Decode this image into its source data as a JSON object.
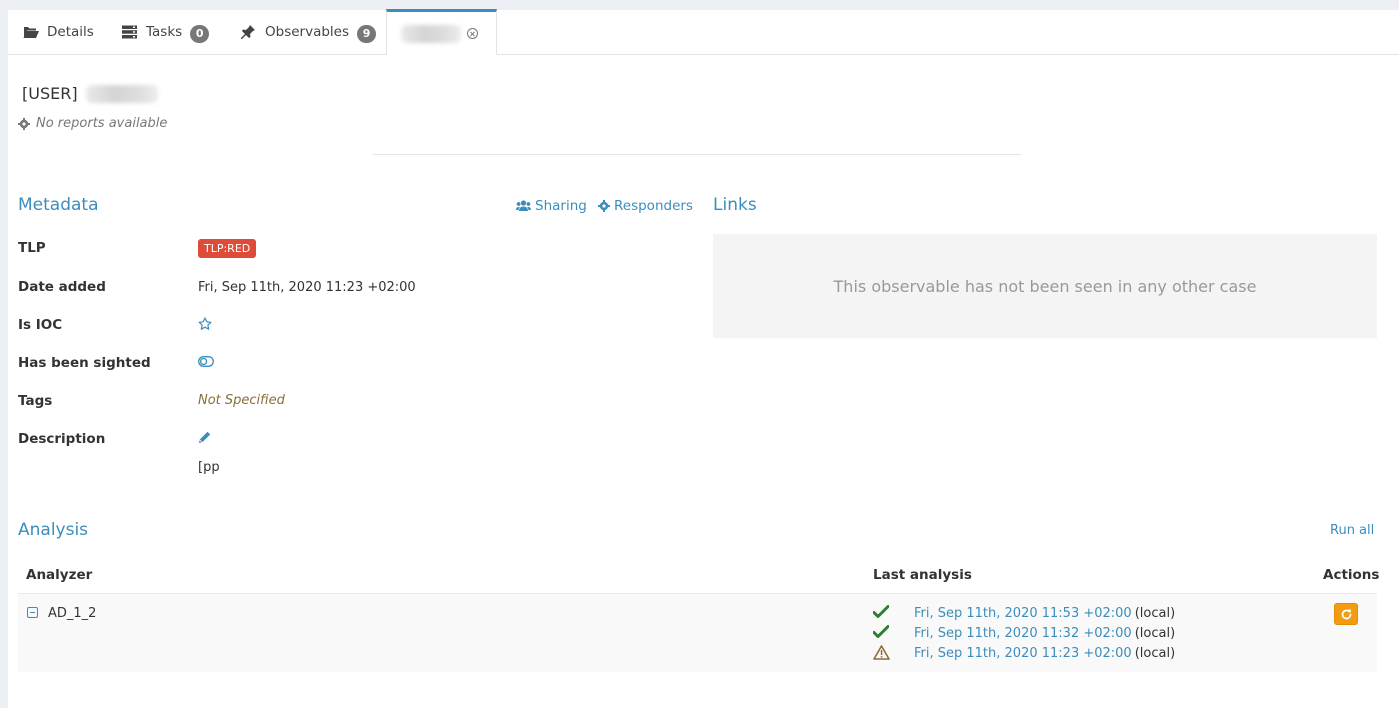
{
  "tabs": {
    "details": "Details",
    "tasks": "Tasks",
    "tasks_count": "0",
    "observables": "Observables",
    "observables_count": "9"
  },
  "observable": {
    "title_prefix": "[USER]",
    "no_reports": "No reports available"
  },
  "metadata": {
    "title": "Metadata",
    "sharing": "Sharing",
    "responders": "Responders",
    "fields": {
      "tlp_label": "TLP",
      "tlp_value": "TLP:RED",
      "date_label": "Date added",
      "date_value": "Fri, Sep 11th, 2020 11:23 +02:00",
      "ioc_label": "Is IOC",
      "sighted_label": "Has been sighted",
      "tags_label": "Tags",
      "tags_value": "Not Specified",
      "description_label": "Description",
      "description_value": "[pp"
    }
  },
  "links": {
    "title": "Links",
    "empty_message": "This observable has not been seen in any other case"
  },
  "analysis": {
    "title": "Analysis",
    "run_all": "Run all",
    "columns": {
      "analyzer": "Analyzer",
      "last_analysis": "Last analysis",
      "actions": "Actions"
    },
    "rows": [
      {
        "analyzer": "AD_1_2",
        "jobs": [
          {
            "status": "success",
            "date": "Fri, Sep 11th, 2020 11:53 +02:00",
            "source": "(local)"
          },
          {
            "status": "success",
            "date": "Fri, Sep 11th, 2020 11:32 +02:00",
            "source": "(local)"
          },
          {
            "status": "warning",
            "date": "Fri, Sep 11th, 2020 11:23 +02:00",
            "source": "(local)"
          }
        ]
      }
    ]
  },
  "colors": {
    "accent": "#3c8dbc",
    "tlp_red": "#dd4b39",
    "success": "#2e7d32",
    "warning": "#8a6d3b",
    "action_button": "#f39c12"
  }
}
